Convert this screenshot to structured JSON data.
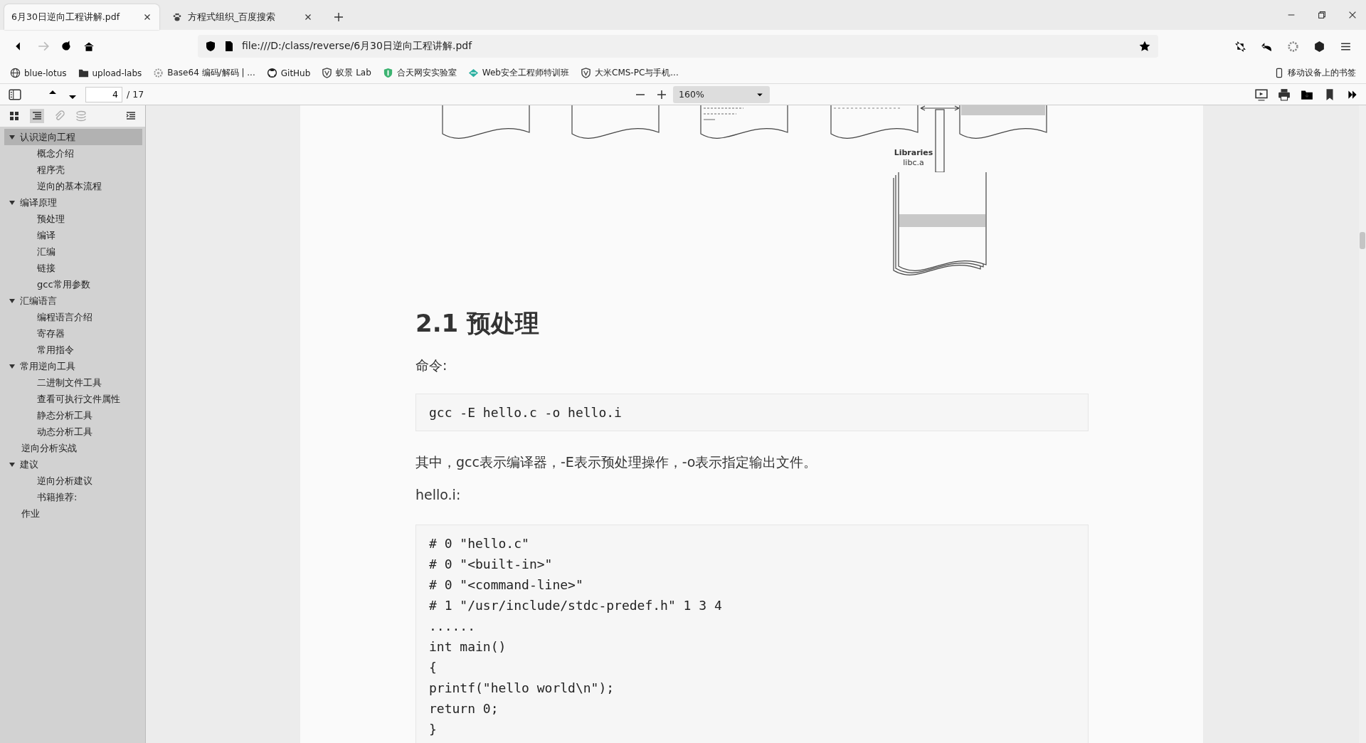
{
  "tabs": [
    {
      "title": "6月30日逆向工程讲解.pdf",
      "selected": true
    },
    {
      "title": "方程式组织_百度搜索",
      "selected": false
    }
  ],
  "address": "file:///D:/class/reverse/6月30日逆向工程讲解.pdf",
  "bookmarks": [
    {
      "label": "blue-lotus"
    },
    {
      "label": "upload-labs"
    },
    {
      "label": "Base64 编码/解码 | ..."
    },
    {
      "label": "GitHub"
    },
    {
      "label": "蚁景 Lab"
    },
    {
      "label": "合天网安实验室"
    },
    {
      "label": "Web安全工程师特训班"
    },
    {
      "label": "大米CMS-PC与手机..."
    }
  ],
  "mobile_bookmarks": "移动设备上的书签",
  "pdf_toolbar": {
    "page": "4",
    "page_count": "/ 17",
    "zoom": "160%"
  },
  "outline": [
    {
      "label": "认识逆向工程",
      "expanded": true,
      "selected": true,
      "children": [
        {
          "label": "概念介绍",
          "selected": false
        },
        {
          "label": "程序壳",
          "selected": false
        },
        {
          "label": "逆向的基本流程",
          "selected": false
        }
      ]
    },
    {
      "label": "编译原理",
      "expanded": true,
      "selected": false,
      "children": [
        {
          "label": "预处理",
          "selected": false
        },
        {
          "label": "编译",
          "selected": false
        },
        {
          "label": "汇编",
          "selected": false
        },
        {
          "label": "链接",
          "selected": false
        },
        {
          "label": "gcc常用参数",
          "selected": false
        }
      ]
    },
    {
      "label": "汇编语言",
      "expanded": true,
      "selected": false,
      "children": [
        {
          "label": "编程语言介绍",
          "selected": false
        },
        {
          "label": "寄存器",
          "selected": false
        },
        {
          "label": "常用指令",
          "selected": false
        }
      ]
    },
    {
      "label": "常用逆向工具",
      "expanded": true,
      "selected": false,
      "children": [
        {
          "label": "二进制文件工具",
          "selected": false
        },
        {
          "label": "查看可执行文件属性",
          "selected": false
        },
        {
          "label": "静态分析工具",
          "selected": false
        },
        {
          "label": "动态分析工具",
          "selected": false
        }
      ]
    },
    {
      "label": "逆向分析实战",
      "selected": false
    },
    {
      "label": "建议",
      "expanded": true,
      "selected": false,
      "children": [
        {
          "label": "逆向分析建议",
          "selected": false
        },
        {
          "label": "书籍推荐:",
          "selected": false
        }
      ]
    },
    {
      "label": "作业",
      "selected": false
    }
  ],
  "document": {
    "diagram": {
      "label_1": "Libraries",
      "label_2": "libc.a"
    },
    "heading": "2.1 预处理",
    "command_label": "命令:",
    "command": "gcc -E hello.c -o hello.i",
    "explanation": "其中，gcc表示编译器，-E表示预处理操作，-o表示指定输出文件。",
    "file_label": "hello.i:",
    "code_lines": [
      "# 0 \"hello.c\"",
      "# 0 \"<built-in>\"",
      "# 0 \"<command-line>\"",
      "# 1 \"/usr/include/stdc-predef.h\" 1 3 4",
      "......",
      "int main()",
      "{",
      "printf(\"hello world\\n\");",
      "return 0;",
      "}"
    ]
  }
}
